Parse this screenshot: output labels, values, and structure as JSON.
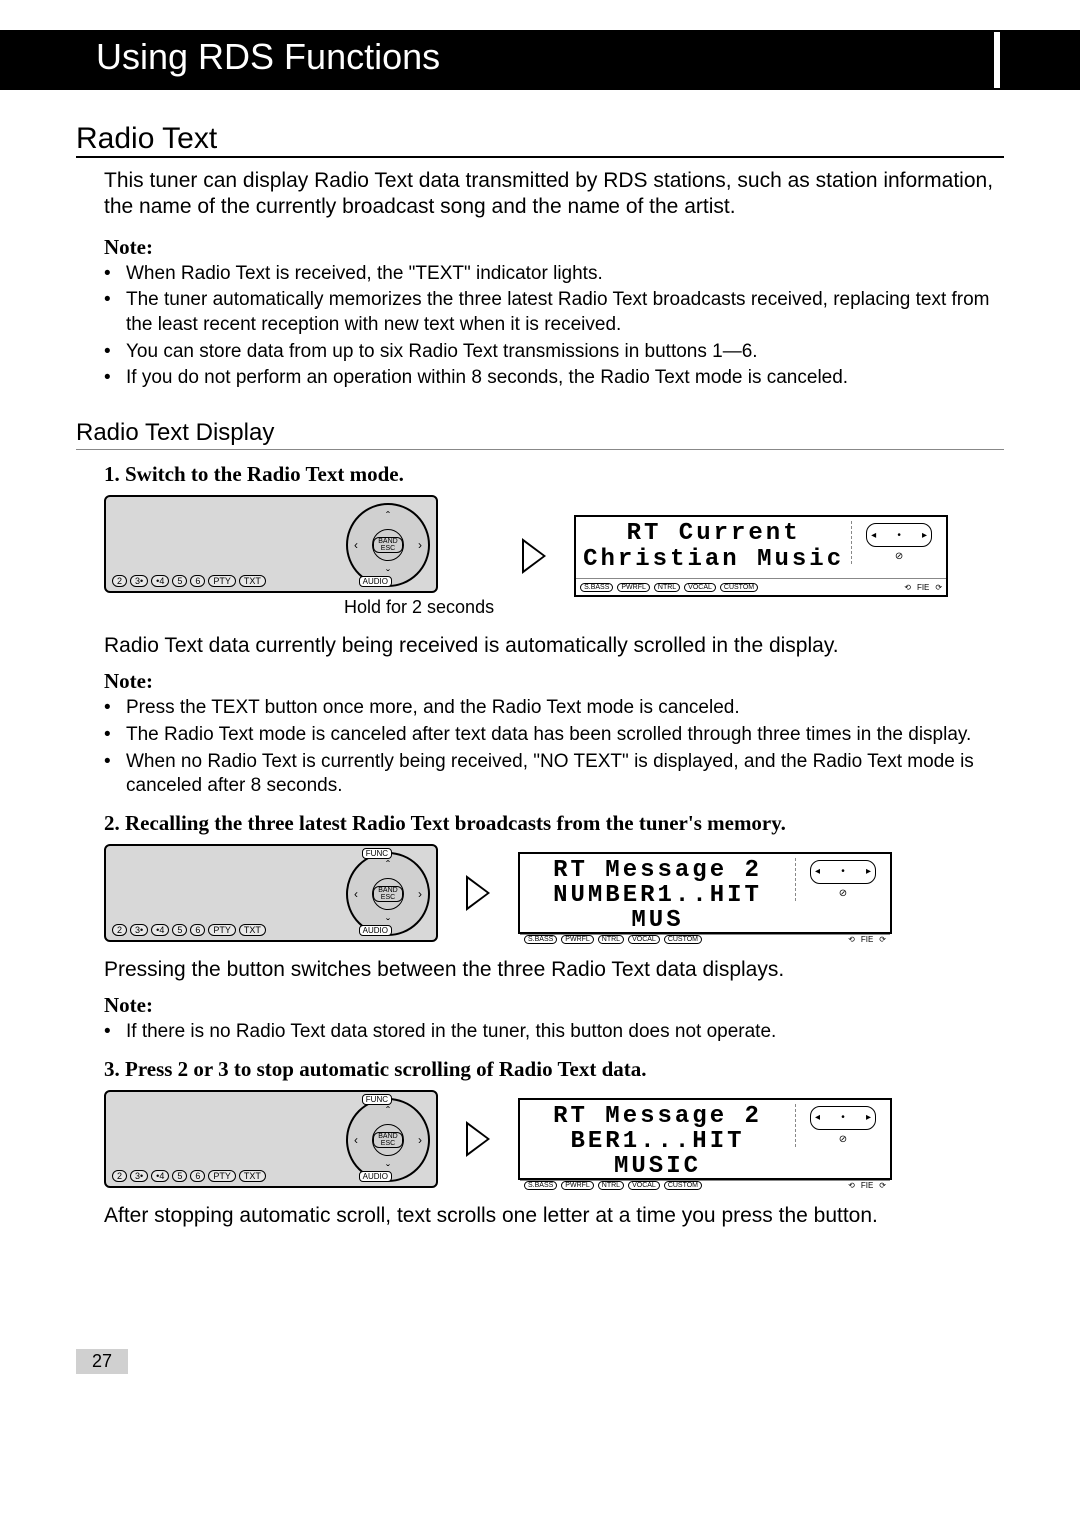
{
  "header": {
    "title": "Using RDS Functions"
  },
  "section": {
    "title": "Radio Text"
  },
  "intro": "This tuner can display Radio Text data transmitted by RDS stations, such as station information, the name of the currently broadcast song and the name of the artist.",
  "note1": {
    "heading": "Note:",
    "items": [
      "When Radio Text is received, the \"TEXT\" indicator lights.",
      "The tuner automatically memorizes the three latest Radio Text broadcasts received, replacing text from the least recent reception with new text when it is received.",
      "You can store data from up to six Radio Text transmissions in buttons 1—6.",
      "If you do not perform an operation within 8 seconds, the Radio Text mode is canceled."
    ]
  },
  "subsection": "Radio Text Display",
  "step1": {
    "heading": "1. Switch to the Radio Text mode.",
    "hold_caption": "Hold for 2 seconds",
    "lcd": {
      "line1": "RT Current",
      "line2": "Christian Music"
    },
    "body": "Radio Text data currently being received is automatically scrolled in the display."
  },
  "note2": {
    "heading": "Note:",
    "items": [
      "Press the TEXT button once more, and the Radio Text mode is canceled.",
      "The Radio Text mode is canceled after text data has been scrolled through three times in the display.",
      "When no Radio Text is currently being received, \"NO TEXT\" is displayed, and the Radio Text mode is canceled after 8 seconds."
    ]
  },
  "step2": {
    "heading": "2. Recalling the three latest Radio Text broadcasts from the tuner's memory.",
    "lcd": {
      "line1": "RT Message 2",
      "line2": "NUMBER1..HIT MUS"
    },
    "body": "Pressing the button switches between the three Radio Text data displays."
  },
  "note3": {
    "heading": "Note:",
    "items": [
      "If there is no Radio Text data stored in the tuner, this button does not operate."
    ]
  },
  "step3": {
    "heading": "3. Press 2 or 3 to stop automatic scrolling of Radio Text data.",
    "lcd": {
      "line1": "RT Message 2",
      "line2": "BER1...HIT MUSIC"
    },
    "body": "After stopping automatic scroll, text scrolls one letter at a time you press the button."
  },
  "device": {
    "buttons": [
      "2",
      "3•",
      "•4",
      "5",
      "6",
      "PTY",
      "TXT"
    ],
    "audio": "AUDIO",
    "func": "FUNC",
    "band": "BAND\nESC"
  },
  "lcd_common": {
    "tags": [
      "S.BASS",
      "PWRFL",
      "NTRL",
      "VOCAL",
      "CUSTOM"
    ],
    "right": "FIE"
  },
  "page_number": "27"
}
